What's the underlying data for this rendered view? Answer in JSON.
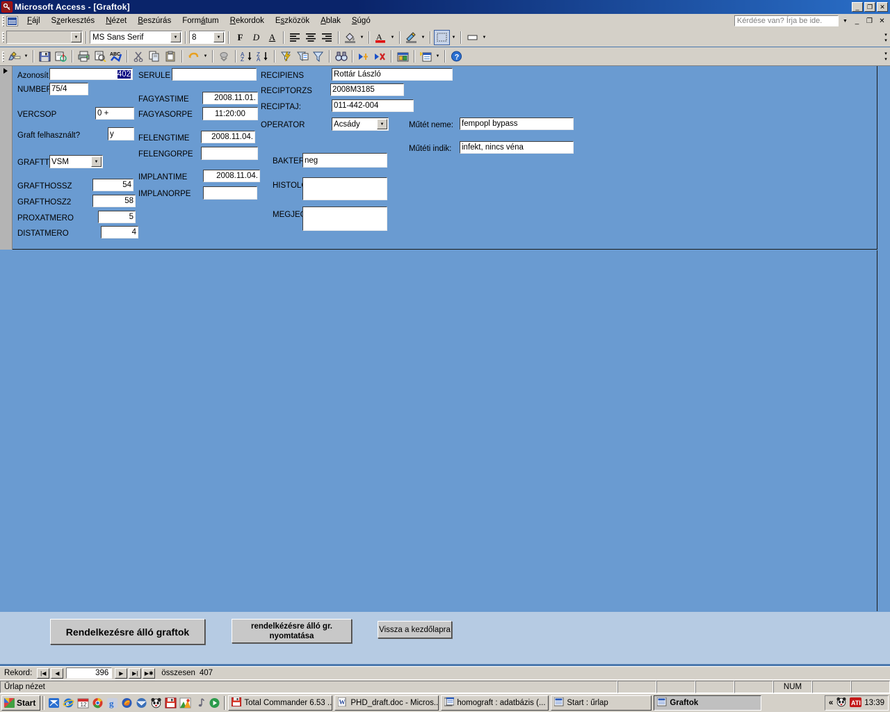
{
  "window": {
    "title": "Microsoft Access - [Graftok]",
    "app_icon": "access-key-icon",
    "minimize": "_",
    "maximize": "❐",
    "close": "✕"
  },
  "menubar": {
    "system_icon": "access-form-icon",
    "items": [
      {
        "label": "Fájl",
        "accel": "F"
      },
      {
        "label": "Szerkesztés",
        "accel": "z"
      },
      {
        "label": "Nézet",
        "accel": "N"
      },
      {
        "label": "Beszúrás",
        "accel": "B"
      },
      {
        "label": "Formátum",
        "accel": "á"
      },
      {
        "label": "Rekordok",
        "accel": "R"
      },
      {
        "label": "Eszközök",
        "accel": "s"
      },
      {
        "label": "Ablak",
        "accel": "A"
      },
      {
        "label": "Súgó",
        "accel": "S"
      }
    ],
    "ask_placeholder": "Kérdése van? Írja be ide.",
    "mdi_minimize": "_",
    "mdi_restore": "❐",
    "mdi_close": "✕"
  },
  "toolbar_format": {
    "object_combo_value": "",
    "font_combo_value": "MS Sans Serif",
    "size_combo_value": "8",
    "buttons": [
      {
        "name": "bold-button",
        "label": "F"
      },
      {
        "name": "italic-button",
        "label": "D"
      },
      {
        "name": "underline-button",
        "label": "A"
      },
      {
        "name": "align-left-button",
        "label": "align-left-icon"
      },
      {
        "name": "align-center-button",
        "label": "align-center-icon"
      },
      {
        "name": "align-right-button",
        "label": "align-right-icon"
      },
      {
        "name": "fill-color-button",
        "label": "paint-bucket-icon"
      },
      {
        "name": "font-color-button",
        "label": "font-color-icon"
      },
      {
        "name": "line-color-button",
        "label": "line-color-icon"
      },
      {
        "name": "special-effect-button",
        "label": "special-effect-icon"
      },
      {
        "name": "line-width-button",
        "label": "line-width-icon"
      }
    ]
  },
  "toolbar_main": {
    "buttons": [
      {
        "name": "view-design-button",
        "label": "design-view-icon"
      },
      {
        "name": "save-button",
        "label": "floppy-save-icon"
      },
      {
        "name": "print-preview-snapshot-button",
        "label": "snapshot-icon"
      },
      {
        "name": "print-button",
        "label": "printer-icon"
      },
      {
        "name": "print-preview-button",
        "label": "print-preview-icon"
      },
      {
        "name": "spelling-button",
        "label": "spelling-abc-icon"
      },
      {
        "name": "cut-button",
        "label": "scissors-icon"
      },
      {
        "name": "copy-button",
        "label": "copy-icon"
      },
      {
        "name": "paste-button",
        "label": "clipboard-paste-icon"
      },
      {
        "name": "undo-button",
        "label": "undo-arrow-icon"
      },
      {
        "name": "insert-hyperlink-button",
        "label": "hyperlink-chain-icon"
      },
      {
        "name": "sort-ascending-button",
        "label": "sort-az-icon"
      },
      {
        "name": "sort-descending-button",
        "label": "sort-za-icon"
      },
      {
        "name": "filter-by-selection-button",
        "label": "filter-lightning-icon"
      },
      {
        "name": "filter-by-form-button",
        "label": "filter-by-form-icon"
      },
      {
        "name": "apply-filter-button",
        "label": "funnel-icon"
      },
      {
        "name": "find-button",
        "label": "binoculars-icon"
      },
      {
        "name": "new-record-button",
        "label": "new-record-icon"
      },
      {
        "name": "delete-record-button",
        "label": "delete-record-icon"
      },
      {
        "name": "database-window-button",
        "label": "database-window-icon"
      },
      {
        "name": "new-object-button",
        "label": "new-object-icon"
      },
      {
        "name": "help-button",
        "label": "help-question-icon"
      }
    ]
  },
  "form": {
    "record_selector": "current-record-arrow",
    "fields": [
      {
        "name": "azonosit",
        "label": "Azonosít",
        "value": "402",
        "selected": true,
        "align": "right"
      },
      {
        "name": "number",
        "label": "NUMBER",
        "value": "75/4",
        "align": "left"
      },
      {
        "name": "vercsop",
        "label": "VERCSOP",
        "value": "0 +",
        "align": "left"
      },
      {
        "name": "graft-felhasznalt",
        "label": "Graft felhasznált?",
        "value": "y",
        "align": "left"
      },
      {
        "name": "graftt",
        "label": "GRAFTT",
        "value": "VSM",
        "type": "combo"
      },
      {
        "name": "grafthossz",
        "label": "GRAFTHOSSZ",
        "value": "54",
        "align": "right"
      },
      {
        "name": "grafthosz2",
        "label": "GRAFTHOSZ2",
        "value": "58",
        "align": "right"
      },
      {
        "name": "proxatmero",
        "label": "PROXATMERO",
        "value": "5",
        "align": "right"
      },
      {
        "name": "distatmero",
        "label": "DISTATMERO",
        "value": "4",
        "align": "right"
      },
      {
        "name": "serule",
        "label": "SERULE",
        "value": "",
        "align": "left"
      },
      {
        "name": "fagyastime",
        "label": "FAGYASTIME",
        "value": "2008.11.01.",
        "align": "right"
      },
      {
        "name": "fagyasorpe",
        "label": "FAGYASORPE",
        "value": "11:20:00",
        "align": "center"
      },
      {
        "name": "felengtime",
        "label": "FELENGTIME",
        "value": "2008.11.04.",
        "align": "right"
      },
      {
        "name": "felengorpe",
        "label": "FELENGORPE",
        "value": "",
        "align": "center"
      },
      {
        "name": "implantime",
        "label": "IMPLANTIME",
        "value": "2008.11.04.",
        "align": "right"
      },
      {
        "name": "implanorpe",
        "label": "IMPLANORPE",
        "value": "",
        "align": "center"
      },
      {
        "name": "recipiens",
        "label": "RECIPIENS",
        "value": "Rottár László",
        "align": "left"
      },
      {
        "name": "reciptorzs",
        "label": "RECIPTORZS",
        "value": "2008M3185",
        "align": "left"
      },
      {
        "name": "receptaj",
        "label": "RECIPTAJ:",
        "value": "011-442-004",
        "align": "left"
      },
      {
        "name": "operator",
        "label": "OPERATOR",
        "value": "Acsády",
        "type": "combo"
      },
      {
        "name": "bakter",
        "label": "BAKTER",
        "value": "neg",
        "align": "left"
      },
      {
        "name": "histolo",
        "label": "HISTOLO",
        "value": "",
        "align": "left"
      },
      {
        "name": "megjeg",
        "label": "MEGJEG",
        "value": "",
        "align": "left"
      },
      {
        "name": "mutet-neme",
        "label": "Műtét neme:",
        "value": "fempopl bypass",
        "align": "left"
      },
      {
        "name": "muteti-indik",
        "label": "Műtéti indik:",
        "value": "infekt, nincs véna",
        "align": "left"
      }
    ],
    "buttons": [
      {
        "name": "available-grafts-button",
        "label": "Rendelkezésre álló graftok"
      },
      {
        "name": "print-available-grafts-button",
        "label_line1": "rendelkézésre álló gr.",
        "label_line2": "nyomtatása"
      },
      {
        "name": "back-to-home-button",
        "label": "Vissza a kezdőlapra"
      }
    ]
  },
  "navbar": {
    "label": "Rekord:",
    "first": "|◀",
    "prev": "◀",
    "current": "396",
    "next": "▶",
    "last": "▶|",
    "new": "▶✱",
    "total_label": "összesen",
    "total_value": "407"
  },
  "statusbar": {
    "message": "Űrlap nézet",
    "cells": [
      "",
      "",
      "",
      "",
      "NUM",
      "",
      ""
    ]
  },
  "taskbar": {
    "start_label": "Start",
    "quicklaunch": [
      {
        "name": "ql-outlook-express-icon"
      },
      {
        "name": "ql-internet-explorer-icon"
      },
      {
        "name": "ql-calendar-icon"
      },
      {
        "name": "ql-chrome-icon"
      },
      {
        "name": "ql-google-icon"
      },
      {
        "name": "ql-firefox-icon"
      },
      {
        "name": "ql-thunderbird-icon"
      },
      {
        "name": "ql-panda-antivirus-icon"
      },
      {
        "name": "ql-total-commander-icon"
      },
      {
        "name": "ql-picasa-icon"
      },
      {
        "name": "ql-music-note-icon"
      },
      {
        "name": "ql-media-player-icon"
      }
    ],
    "tasks": [
      {
        "name": "task-total-commander",
        "label": "Total Commander 6.53 ...",
        "icon": "floppy-icon",
        "active": false
      },
      {
        "name": "task-word-doc",
        "label": "PHD_draft.doc - Micros...",
        "icon": "word-icon",
        "active": false
      },
      {
        "name": "task-homograft-db",
        "label": "homograft : adatbázis (...",
        "icon": "access-db-icon",
        "active": false
      },
      {
        "name": "task-start-form",
        "label": "Start : űrlap",
        "icon": "access-form-icon",
        "active": false
      },
      {
        "name": "task-graftok",
        "label": "Graftok",
        "icon": "access-form-icon",
        "active": true
      }
    ],
    "tray": {
      "expand": "«",
      "icons": [
        {
          "name": "tray-panda-antivirus-icon"
        },
        {
          "name": "tray-ati-icon"
        }
      ],
      "clock": "13:39"
    }
  }
}
